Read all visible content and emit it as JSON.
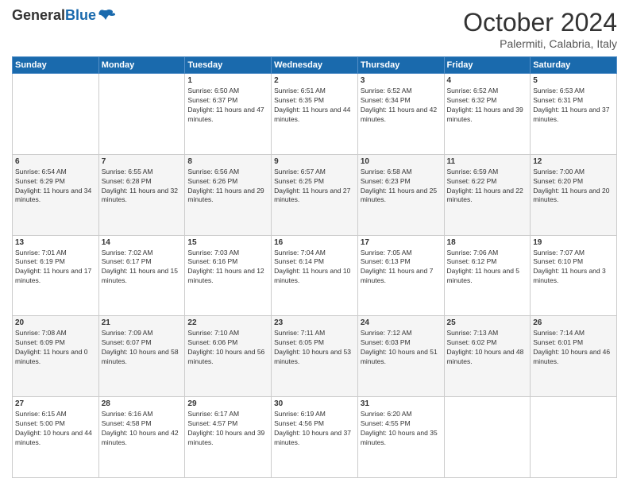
{
  "header": {
    "logo_general": "General",
    "logo_blue": "Blue",
    "month": "October 2024",
    "location": "Palermiti, Calabria, Italy"
  },
  "weekdays": [
    "Sunday",
    "Monday",
    "Tuesday",
    "Wednesday",
    "Thursday",
    "Friday",
    "Saturday"
  ],
  "weeks": [
    [
      {
        "day": "",
        "info": ""
      },
      {
        "day": "",
        "info": ""
      },
      {
        "day": "1",
        "info": "Sunrise: 6:50 AM\nSunset: 6:37 PM\nDaylight: 11 hours and 47 minutes."
      },
      {
        "day": "2",
        "info": "Sunrise: 6:51 AM\nSunset: 6:35 PM\nDaylight: 11 hours and 44 minutes."
      },
      {
        "day": "3",
        "info": "Sunrise: 6:52 AM\nSunset: 6:34 PM\nDaylight: 11 hours and 42 minutes."
      },
      {
        "day": "4",
        "info": "Sunrise: 6:52 AM\nSunset: 6:32 PM\nDaylight: 11 hours and 39 minutes."
      },
      {
        "day": "5",
        "info": "Sunrise: 6:53 AM\nSunset: 6:31 PM\nDaylight: 11 hours and 37 minutes."
      }
    ],
    [
      {
        "day": "6",
        "info": "Sunrise: 6:54 AM\nSunset: 6:29 PM\nDaylight: 11 hours and 34 minutes."
      },
      {
        "day": "7",
        "info": "Sunrise: 6:55 AM\nSunset: 6:28 PM\nDaylight: 11 hours and 32 minutes."
      },
      {
        "day": "8",
        "info": "Sunrise: 6:56 AM\nSunset: 6:26 PM\nDaylight: 11 hours and 29 minutes."
      },
      {
        "day": "9",
        "info": "Sunrise: 6:57 AM\nSunset: 6:25 PM\nDaylight: 11 hours and 27 minutes."
      },
      {
        "day": "10",
        "info": "Sunrise: 6:58 AM\nSunset: 6:23 PM\nDaylight: 11 hours and 25 minutes."
      },
      {
        "day": "11",
        "info": "Sunrise: 6:59 AM\nSunset: 6:22 PM\nDaylight: 11 hours and 22 minutes."
      },
      {
        "day": "12",
        "info": "Sunrise: 7:00 AM\nSunset: 6:20 PM\nDaylight: 11 hours and 20 minutes."
      }
    ],
    [
      {
        "day": "13",
        "info": "Sunrise: 7:01 AM\nSunset: 6:19 PM\nDaylight: 11 hours and 17 minutes."
      },
      {
        "day": "14",
        "info": "Sunrise: 7:02 AM\nSunset: 6:17 PM\nDaylight: 11 hours and 15 minutes."
      },
      {
        "day": "15",
        "info": "Sunrise: 7:03 AM\nSunset: 6:16 PM\nDaylight: 11 hours and 12 minutes."
      },
      {
        "day": "16",
        "info": "Sunrise: 7:04 AM\nSunset: 6:14 PM\nDaylight: 11 hours and 10 minutes."
      },
      {
        "day": "17",
        "info": "Sunrise: 7:05 AM\nSunset: 6:13 PM\nDaylight: 11 hours and 7 minutes."
      },
      {
        "day": "18",
        "info": "Sunrise: 7:06 AM\nSunset: 6:12 PM\nDaylight: 11 hours and 5 minutes."
      },
      {
        "day": "19",
        "info": "Sunrise: 7:07 AM\nSunset: 6:10 PM\nDaylight: 11 hours and 3 minutes."
      }
    ],
    [
      {
        "day": "20",
        "info": "Sunrise: 7:08 AM\nSunset: 6:09 PM\nDaylight: 11 hours and 0 minutes."
      },
      {
        "day": "21",
        "info": "Sunrise: 7:09 AM\nSunset: 6:07 PM\nDaylight: 10 hours and 58 minutes."
      },
      {
        "day": "22",
        "info": "Sunrise: 7:10 AM\nSunset: 6:06 PM\nDaylight: 10 hours and 56 minutes."
      },
      {
        "day": "23",
        "info": "Sunrise: 7:11 AM\nSunset: 6:05 PM\nDaylight: 10 hours and 53 minutes."
      },
      {
        "day": "24",
        "info": "Sunrise: 7:12 AM\nSunset: 6:03 PM\nDaylight: 10 hours and 51 minutes."
      },
      {
        "day": "25",
        "info": "Sunrise: 7:13 AM\nSunset: 6:02 PM\nDaylight: 10 hours and 48 minutes."
      },
      {
        "day": "26",
        "info": "Sunrise: 7:14 AM\nSunset: 6:01 PM\nDaylight: 10 hours and 46 minutes."
      }
    ],
    [
      {
        "day": "27",
        "info": "Sunrise: 6:15 AM\nSunset: 5:00 PM\nDaylight: 10 hours and 44 minutes."
      },
      {
        "day": "28",
        "info": "Sunrise: 6:16 AM\nSunset: 4:58 PM\nDaylight: 10 hours and 42 minutes."
      },
      {
        "day": "29",
        "info": "Sunrise: 6:17 AM\nSunset: 4:57 PM\nDaylight: 10 hours and 39 minutes."
      },
      {
        "day": "30",
        "info": "Sunrise: 6:19 AM\nSunset: 4:56 PM\nDaylight: 10 hours and 37 minutes."
      },
      {
        "day": "31",
        "info": "Sunrise: 6:20 AM\nSunset: 4:55 PM\nDaylight: 10 hours and 35 minutes."
      },
      {
        "day": "",
        "info": ""
      },
      {
        "day": "",
        "info": ""
      }
    ]
  ]
}
